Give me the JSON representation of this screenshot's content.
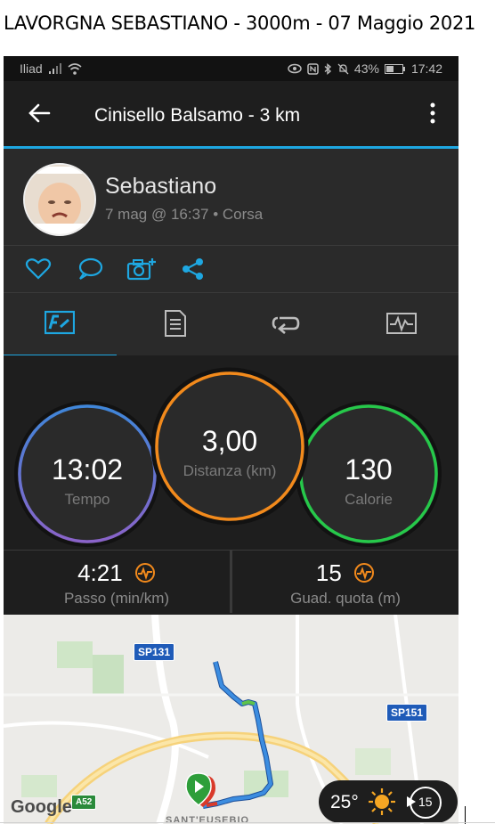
{
  "document": {
    "title": "LAVORGNA SEBASTIANO  -  3000m  -  07 Maggio 2021"
  },
  "status_bar": {
    "carrier": "Iliad",
    "battery": "43%",
    "time": "17:42"
  },
  "app_bar": {
    "title": "Cinisello Balsamo - 3 km"
  },
  "profile": {
    "name": "Sebastiano",
    "meta": "7 mag @ 16:37 • Corsa"
  },
  "stats": {
    "time": {
      "value": "13:02",
      "label": "Tempo"
    },
    "distance": {
      "value": "3,00",
      "label": "Distanza (km)"
    },
    "calories": {
      "value": "130",
      "label": "Calorie"
    }
  },
  "metrics": {
    "pace": {
      "value": "4:21",
      "label": "Passo (min/km)"
    },
    "elevation": {
      "value": "15",
      "label": "Guad. quota (m)"
    }
  },
  "map": {
    "road_labels": [
      "SP131",
      "SP151",
      "A52"
    ],
    "area_label": "SANT'EUSEBIO",
    "google": "Google"
  },
  "weather": {
    "temperature": "25°",
    "wind": "15"
  },
  "colors": {
    "accent": "#1ea7e1",
    "time_ring": "#4a7fd6",
    "distance_ring": "#f28a1c",
    "calories_ring": "#26c84a",
    "route": "#3c8de0"
  }
}
